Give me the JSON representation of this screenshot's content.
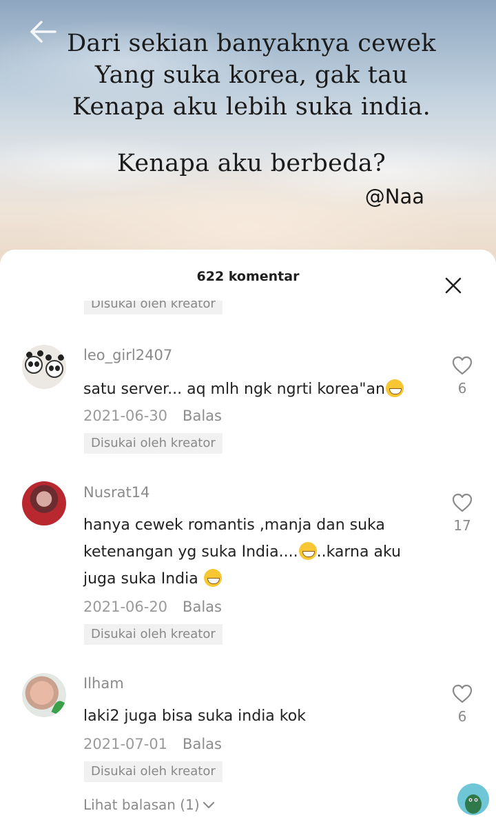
{
  "post": {
    "lines": [
      "Dari sekian banyaknya cewek",
      "Yang suka korea,  gak tau",
      "Kenapa aku lebih suka india.",
      "Kenapa aku berbeda?"
    ],
    "author": "@Naa"
  },
  "sheet": {
    "title": "622 komentar",
    "cut_badge": "Disukai oleh kreator"
  },
  "comments": [
    {
      "username": "leo_girl2407",
      "text": "satu server... aq mlh ngk ngrti korea\"an",
      "date": "2021-06-30",
      "reply_label": "Balas",
      "badge": "Disukai oleh kreator",
      "likes": "6",
      "emoji": "grinning-face"
    },
    {
      "username": "Nusrat14",
      "text_lines": [
        "hanya cewek romantis ,manja dan suka",
        "ketenangan yg suka India....",
        "..karna aku",
        "juga suka India "
      ],
      "date": "2021-06-20",
      "reply_label": "Balas",
      "badge": "Disukai oleh kreator",
      "likes": "17",
      "emoji": "grinning-face"
    },
    {
      "username": "Ilham",
      "text": "laki2 juga bisa suka india kok",
      "date": "2021-07-01",
      "reply_label": "Balas",
      "badge": "Disukai oleh kreator",
      "likes": "6"
    }
  ],
  "view_replies": "Lihat balasan (1)",
  "icons": [
    "back-arrow-icon",
    "close-icon",
    "heart-icon",
    "chevron-down-icon"
  ],
  "colors": {
    "text": "#222222",
    "muted": "#8a8a8a",
    "badge_bg": "#f1f1f1"
  }
}
